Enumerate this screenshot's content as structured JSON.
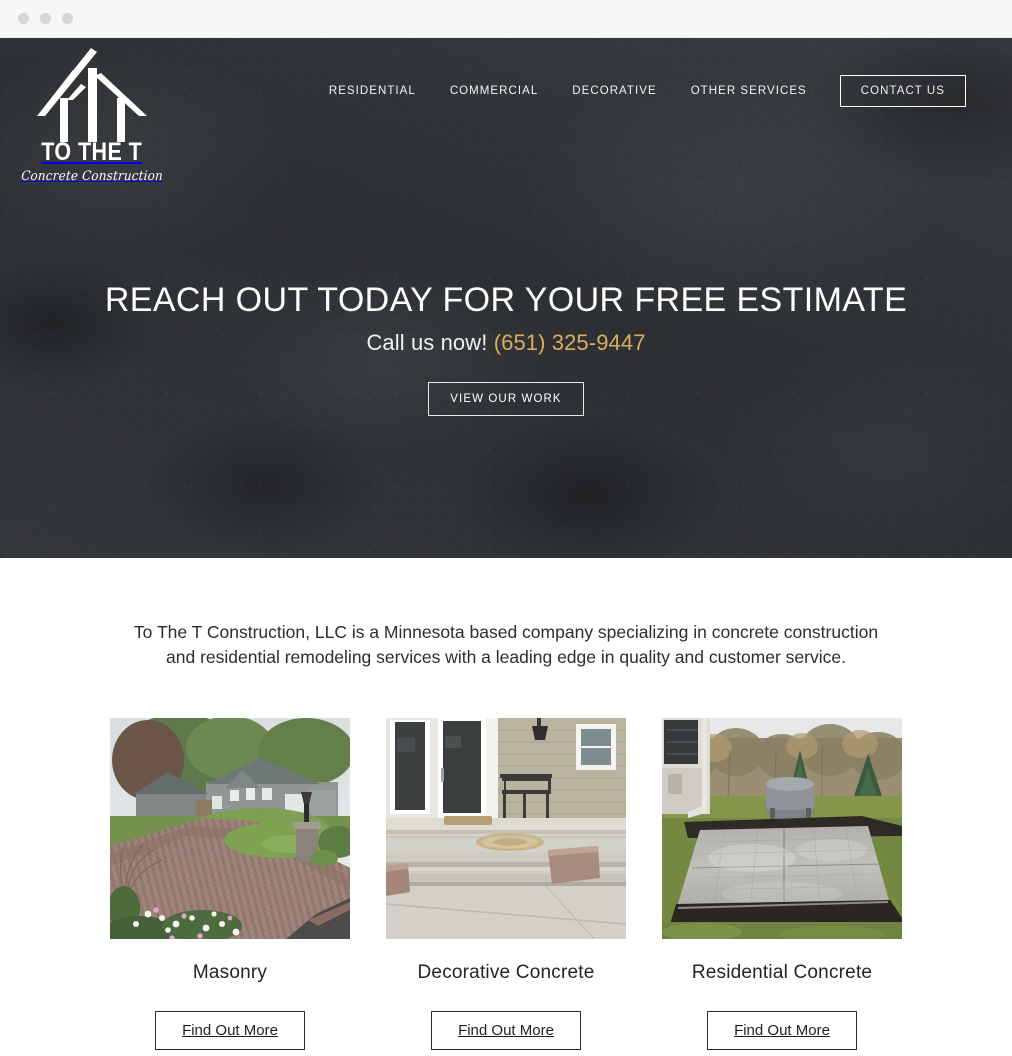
{
  "browser": {
    "dots": [
      "window-dot-1",
      "window-dot-2",
      "window-dot-3"
    ]
  },
  "header": {
    "logo": {
      "name": "TO THE T",
      "tagline": "Concrete Construction"
    },
    "nav": [
      {
        "label": "RESIDENTIAL"
      },
      {
        "label": "COMMERCIAL"
      },
      {
        "label": "DECORATIVE"
      },
      {
        "label": "OTHER SERVICES"
      }
    ],
    "cta_label": "CONTACT US"
  },
  "hero": {
    "title": "REACH OUT TODAY FOR YOUR FREE ESTIMATE",
    "subtitle_prefix": "Call us now!",
    "phone": "(651) 325-9447",
    "button_label": "VIEW OUR WORK",
    "phone_color": "#d8ad5c",
    "background_color": "#313437"
  },
  "intro": {
    "paragraph": "To The T Construction, LLC is a Minnesota based company specializing in concrete construction and residential remodeling services with a leading edge in quality and customer service."
  },
  "cards": [
    {
      "title": "Masonry",
      "button_label": "Find Out More",
      "image_alt": "paver-driveway-with-house-and-flower-garden"
    },
    {
      "title": "Decorative Concrete",
      "button_label": "Find Out More",
      "image_alt": "concrete-patio-with-steps-and-stamped-medallion"
    },
    {
      "title": "Residential Concrete",
      "button_label": "Find Out More",
      "image_alt": "wet-stamped-concrete-patio-in-backyard"
    }
  ]
}
